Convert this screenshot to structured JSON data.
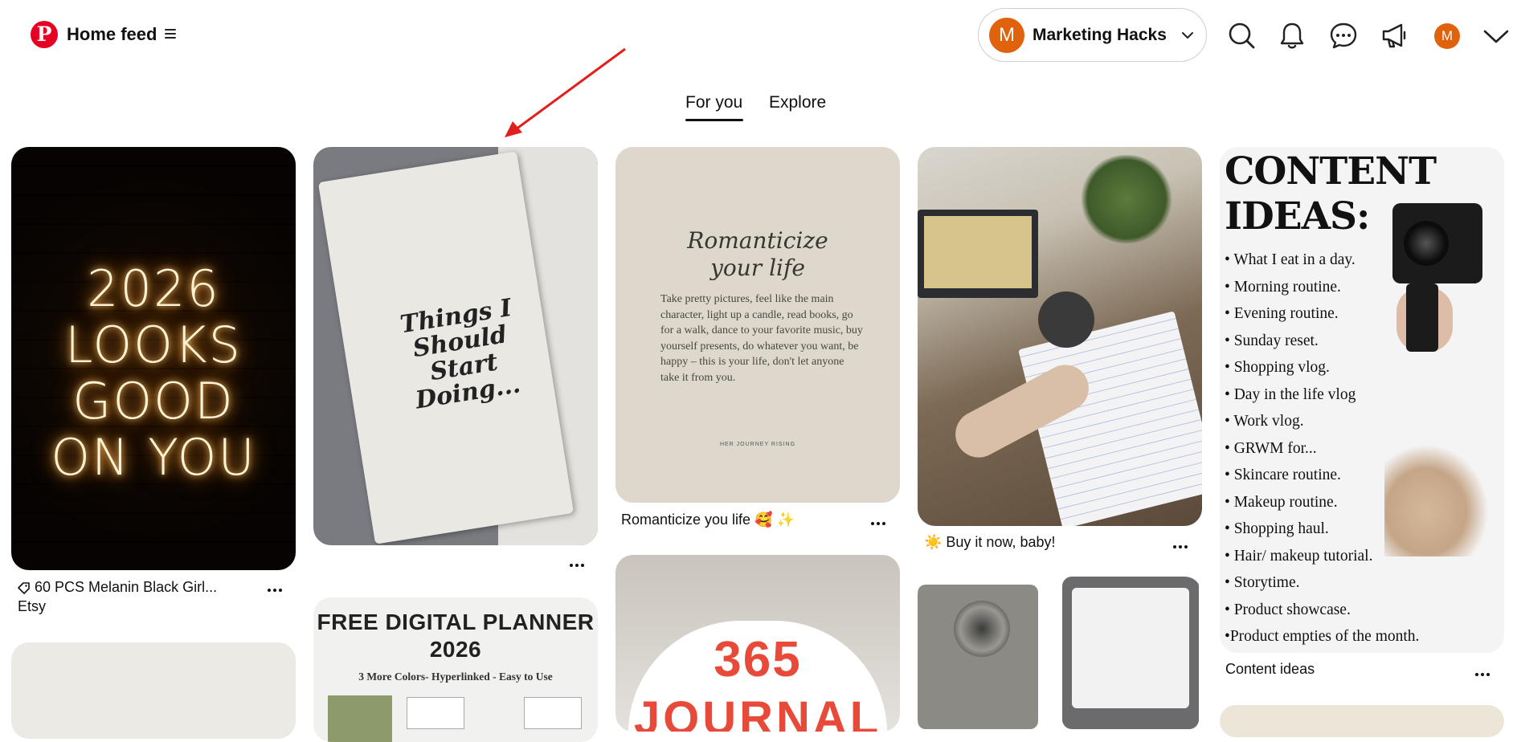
{
  "header": {
    "logo_letter": "P",
    "title": "Home feed",
    "account": {
      "initial": "M",
      "name": "Marketing Hacks"
    },
    "user_initial": "M"
  },
  "tabs": [
    {
      "label": "For you",
      "active": true
    },
    {
      "label": "Explore",
      "active": false
    }
  ],
  "pins": {
    "p1": {
      "neon_lines": [
        "2026",
        "LOOKS",
        "GOOD",
        "ON YOU"
      ],
      "title": "60 PCS Melanin Black Girl...",
      "subtitle": "Etsy"
    },
    "p2": {
      "doodle": "Things I Should Start Doing..."
    },
    "p3": {
      "heading_1": "Romanticize",
      "heading_2": "your life",
      "body": "Take pretty pictures, feel like the main character, light up a candle, read books, go for a walk, dance to your favorite music, buy yourself presents, do whatever you want, be happy – this is your life, don't let anyone take it from you.",
      "footer": "HER JOURNEY RISING",
      "title": "Romanticize you life 🥰 ✨"
    },
    "p4": {
      "title": "☀️ Buy it now, baby!"
    },
    "p5": {
      "heading": [
        "CONTENT",
        "IDEAS:"
      ],
      "items": [
        "• What I eat in a day.",
        "• Morning routine.",
        "• Evening routine.",
        "• Sunday reset.",
        "• Shopping vlog.",
        "• Day in the life vlog",
        "• Work vlog.",
        "• GRWM for...",
        "• Skincare routine.",
        "• Makeup routine.",
        "• Shopping haul.",
        "• Hair/ makeup tutorial.",
        "• Storytime.",
        "• Product showcase.",
        "•Product empties of the month."
      ],
      "title": "Content ideas"
    },
    "p7": {
      "line1": "FREE DIGITAL PLANNER",
      "line2": "2026",
      "tagline": "3 More Colors- Hyperlinked - Easy to Use"
    },
    "p8": {
      "number": "365",
      "word": "JOURNAL"
    }
  },
  "colors": {
    "brand": "#e60023",
    "avatar": "#e0620c",
    "annotation_arrow": "#e0201c"
  }
}
